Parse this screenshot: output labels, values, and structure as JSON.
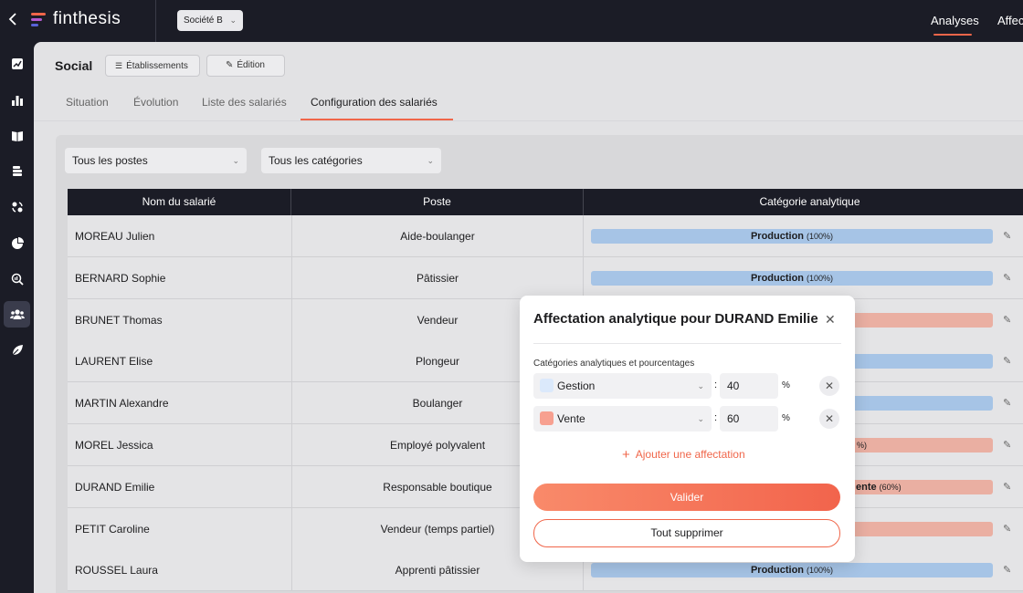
{
  "header": {
    "app_name": "finthesis",
    "company": "Société B",
    "nav": [
      {
        "label": "Analyses"
      },
      {
        "label": "Affec"
      }
    ]
  },
  "sidebar": {
    "items": [
      {
        "icon": "trend-icon"
      },
      {
        "icon": "bar-chart-icon"
      },
      {
        "icon": "book-icon"
      },
      {
        "icon": "coins-icon"
      },
      {
        "icon": "exchange-icon"
      },
      {
        "icon": "pie-chart-icon"
      },
      {
        "icon": "search-analytics-icon"
      },
      {
        "icon": "users-icon",
        "active": true
      },
      {
        "icon": "leaf-icon"
      }
    ]
  },
  "page": {
    "title": "Social",
    "btn_etablissements": "Établissements",
    "btn_edition": "Édition",
    "tabs": [
      {
        "label": "Situation"
      },
      {
        "label": "Évolution"
      },
      {
        "label": "Liste des salariés"
      },
      {
        "label": "Configuration des salariés",
        "active": true
      }
    ],
    "filters": {
      "postes": "Tous les postes",
      "categories": "Tous les catégories"
    }
  },
  "table": {
    "headers": [
      "Nom du salarié",
      "Poste",
      "Catégorie analytique"
    ],
    "rows": [
      {
        "name": "MOREAU Julien",
        "poste": "Aide-boulanger",
        "cat": "Production",
        "pct": "(100%)",
        "color": "#a6c4e6"
      },
      {
        "name": "BERNARD Sophie",
        "poste": "Pâtissier",
        "cat": "Production",
        "pct": "(100%)",
        "color": "#a6c4e6"
      },
      {
        "name": "BRUNET Thomas",
        "poste": "Vendeur",
        "cat": "",
        "pct": "",
        "color": "#eaafa2"
      },
      {
        "name": "LAURENT Elise",
        "poste": "Plongeur",
        "cat": "",
        "pct": "",
        "color": "#a6c4e6"
      },
      {
        "name": "MARTIN Alexandre",
        "poste": "Boulanger",
        "cat": "",
        "pct": "",
        "color": "#a6c4e6"
      },
      {
        "name": "MOREL Jessica",
        "poste": "Employé polyvalent",
        "cat": "",
        "pct": "%)",
        "color": "#eaafa2"
      },
      {
        "name": "DURAND Emilie",
        "poste": "Responsable boutique",
        "cat": "ente",
        "pct": "(60%)",
        "color": "#eaafa2"
      },
      {
        "name": "PETIT Caroline",
        "poste": "Vendeur (temps partiel)",
        "cat": "",
        "pct": "",
        "color": "#eaafa2"
      },
      {
        "name": "ROUSSEL Laura",
        "poste": "Apprenti pâtissier",
        "cat": "Production",
        "pct": "(100%)",
        "color": "#a6c4e6"
      }
    ]
  },
  "modal": {
    "title": "Affectation analytique pour DURAND Emilie",
    "label": "Catégories analytiques et pourcentages",
    "allocations": [
      {
        "category": "Gestion",
        "value": "40",
        "swatch": "#dbe9fb"
      },
      {
        "category": "Vente",
        "value": "60",
        "swatch": "#f7a090"
      }
    ],
    "colon": ":",
    "percent_sign": "%",
    "add_label": "Ajouter une affectation",
    "validate_label": "Valider",
    "delete_all_label": "Tout supprimer"
  },
  "colors": {
    "accent": "#f0664a",
    "dark": "#1b1c26",
    "production_bar": "#a6c4e6",
    "vente_bar": "#eaafa2"
  }
}
